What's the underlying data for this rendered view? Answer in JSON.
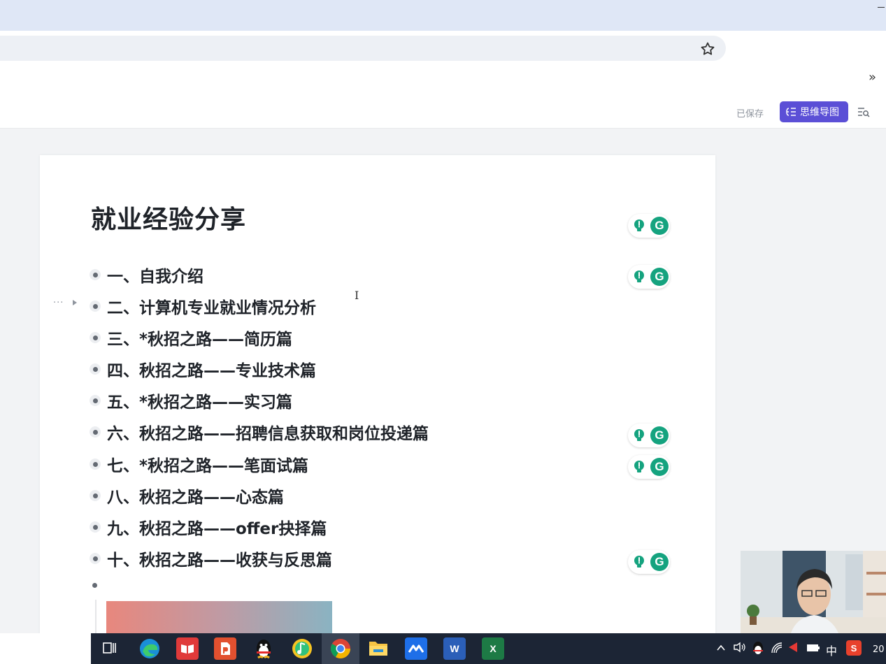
{
  "app_header": {
    "saved_status": "已保存",
    "mindmap_button": "思维导图",
    "mindmap_icon": "mindmap-icon",
    "outline_icon": "outline-icon"
  },
  "browser": {
    "bookmark_icon": "star-icon",
    "more_bookmarks": "»"
  },
  "document": {
    "title": "就业经验分享",
    "items": [
      "一、自我介绍",
      "二、计算机专业就业情况分析",
      "三、*秋招之路——简历篇",
      "四、秋招之路——专业技术篇",
      "五、*秋招之路——实习篇",
      "六、秋招之路——招聘信息获取和岗位投递篇",
      "七、*秋招之路——笔面试篇",
      "八、秋招之路——心态篇",
      "九、秋招之路——offer抉择篇",
      "十、秋招之路——收获与反思篇"
    ],
    "hover_controls": "···"
  },
  "grammarly": {
    "letter": "G"
  },
  "taskbar": {
    "apps": [
      "task-view-icon",
      "edge-icon",
      "reader-icon",
      "slides-icon",
      "qq-icon",
      "music-icon",
      "chrome-icon",
      "file-explorer-icon",
      "feishu-icon",
      "word-icon",
      "excel-icon"
    ],
    "word_letter": "W",
    "excel_letter": "X",
    "ime": "中",
    "clock": "20"
  },
  "colors": {
    "accent": "#5b4fd6",
    "grammarly": "#15a37f",
    "taskbar": "#1c2535"
  }
}
